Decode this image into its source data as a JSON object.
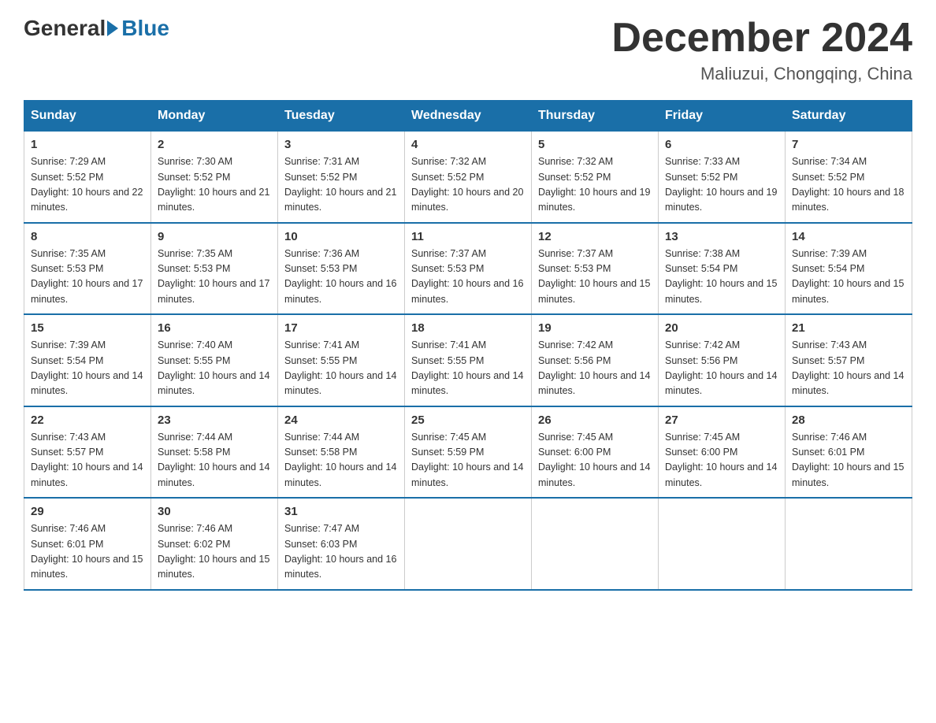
{
  "logo": {
    "general": "General",
    "blue": "Blue"
  },
  "title": {
    "month_year": "December 2024",
    "location": "Maliuzui, Chongqing, China"
  },
  "days_of_week": [
    "Sunday",
    "Monday",
    "Tuesday",
    "Wednesday",
    "Thursday",
    "Friday",
    "Saturday"
  ],
  "weeks": [
    [
      {
        "num": "1",
        "sunrise": "7:29 AM",
        "sunset": "5:52 PM",
        "daylight": "10 hours and 22 minutes."
      },
      {
        "num": "2",
        "sunrise": "7:30 AM",
        "sunset": "5:52 PM",
        "daylight": "10 hours and 21 minutes."
      },
      {
        "num": "3",
        "sunrise": "7:31 AM",
        "sunset": "5:52 PM",
        "daylight": "10 hours and 21 minutes."
      },
      {
        "num": "4",
        "sunrise": "7:32 AM",
        "sunset": "5:52 PM",
        "daylight": "10 hours and 20 minutes."
      },
      {
        "num": "5",
        "sunrise": "7:32 AM",
        "sunset": "5:52 PM",
        "daylight": "10 hours and 19 minutes."
      },
      {
        "num": "6",
        "sunrise": "7:33 AM",
        "sunset": "5:52 PM",
        "daylight": "10 hours and 19 minutes."
      },
      {
        "num": "7",
        "sunrise": "7:34 AM",
        "sunset": "5:52 PM",
        "daylight": "10 hours and 18 minutes."
      }
    ],
    [
      {
        "num": "8",
        "sunrise": "7:35 AM",
        "sunset": "5:53 PM",
        "daylight": "10 hours and 17 minutes."
      },
      {
        "num": "9",
        "sunrise": "7:35 AM",
        "sunset": "5:53 PM",
        "daylight": "10 hours and 17 minutes."
      },
      {
        "num": "10",
        "sunrise": "7:36 AM",
        "sunset": "5:53 PM",
        "daylight": "10 hours and 16 minutes."
      },
      {
        "num": "11",
        "sunrise": "7:37 AM",
        "sunset": "5:53 PM",
        "daylight": "10 hours and 16 minutes."
      },
      {
        "num": "12",
        "sunrise": "7:37 AM",
        "sunset": "5:53 PM",
        "daylight": "10 hours and 15 minutes."
      },
      {
        "num": "13",
        "sunrise": "7:38 AM",
        "sunset": "5:54 PM",
        "daylight": "10 hours and 15 minutes."
      },
      {
        "num": "14",
        "sunrise": "7:39 AM",
        "sunset": "5:54 PM",
        "daylight": "10 hours and 15 minutes."
      }
    ],
    [
      {
        "num": "15",
        "sunrise": "7:39 AM",
        "sunset": "5:54 PM",
        "daylight": "10 hours and 14 minutes."
      },
      {
        "num": "16",
        "sunrise": "7:40 AM",
        "sunset": "5:55 PM",
        "daylight": "10 hours and 14 minutes."
      },
      {
        "num": "17",
        "sunrise": "7:41 AM",
        "sunset": "5:55 PM",
        "daylight": "10 hours and 14 minutes."
      },
      {
        "num": "18",
        "sunrise": "7:41 AM",
        "sunset": "5:55 PM",
        "daylight": "10 hours and 14 minutes."
      },
      {
        "num": "19",
        "sunrise": "7:42 AM",
        "sunset": "5:56 PM",
        "daylight": "10 hours and 14 minutes."
      },
      {
        "num": "20",
        "sunrise": "7:42 AM",
        "sunset": "5:56 PM",
        "daylight": "10 hours and 14 minutes."
      },
      {
        "num": "21",
        "sunrise": "7:43 AM",
        "sunset": "5:57 PM",
        "daylight": "10 hours and 14 minutes."
      }
    ],
    [
      {
        "num": "22",
        "sunrise": "7:43 AM",
        "sunset": "5:57 PM",
        "daylight": "10 hours and 14 minutes."
      },
      {
        "num": "23",
        "sunrise": "7:44 AM",
        "sunset": "5:58 PM",
        "daylight": "10 hours and 14 minutes."
      },
      {
        "num": "24",
        "sunrise": "7:44 AM",
        "sunset": "5:58 PM",
        "daylight": "10 hours and 14 minutes."
      },
      {
        "num": "25",
        "sunrise": "7:45 AM",
        "sunset": "5:59 PM",
        "daylight": "10 hours and 14 minutes."
      },
      {
        "num": "26",
        "sunrise": "7:45 AM",
        "sunset": "6:00 PM",
        "daylight": "10 hours and 14 minutes."
      },
      {
        "num": "27",
        "sunrise": "7:45 AM",
        "sunset": "6:00 PM",
        "daylight": "10 hours and 14 minutes."
      },
      {
        "num": "28",
        "sunrise": "7:46 AM",
        "sunset": "6:01 PM",
        "daylight": "10 hours and 15 minutes."
      }
    ],
    [
      {
        "num": "29",
        "sunrise": "7:46 AM",
        "sunset": "6:01 PM",
        "daylight": "10 hours and 15 minutes."
      },
      {
        "num": "30",
        "sunrise": "7:46 AM",
        "sunset": "6:02 PM",
        "daylight": "10 hours and 15 minutes."
      },
      {
        "num": "31",
        "sunrise": "7:47 AM",
        "sunset": "6:03 PM",
        "daylight": "10 hours and 16 minutes."
      },
      {
        "num": "",
        "sunrise": "",
        "sunset": "",
        "daylight": ""
      },
      {
        "num": "",
        "sunrise": "",
        "sunset": "",
        "daylight": ""
      },
      {
        "num": "",
        "sunrise": "",
        "sunset": "",
        "daylight": ""
      },
      {
        "num": "",
        "sunrise": "",
        "sunset": "",
        "daylight": ""
      }
    ]
  ],
  "labels": {
    "sunrise_prefix": "Sunrise: ",
    "sunset_prefix": "Sunset: ",
    "daylight_prefix": "Daylight: "
  }
}
